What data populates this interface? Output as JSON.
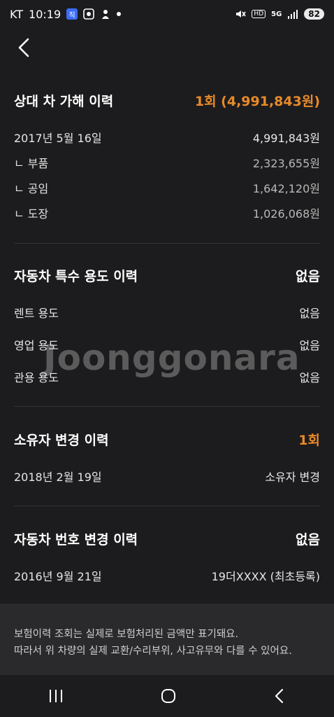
{
  "status_bar": {
    "carrier": "KT",
    "time": "10:19",
    "battery": "82",
    "network": "5G",
    "hd": "HD",
    "app_icon_text": "직"
  },
  "accident": {
    "title": "상대 차 가해 이력",
    "summary": "1회 (4,991,843원)",
    "date": "2017년 5월 16일",
    "total": "4,991,843원",
    "items": [
      {
        "label": "ㄴ 부품",
        "value": "2,323,655원"
      },
      {
        "label": "ㄴ 공임",
        "value": "1,642,120원"
      },
      {
        "label": "ㄴ 도장",
        "value": "1,026,068원"
      }
    ]
  },
  "special_use": {
    "title": "자동차 특수 용도 이력",
    "summary": "없음",
    "items": [
      {
        "label": "렌트 용도",
        "value": "없음"
      },
      {
        "label": "영업 용도",
        "value": "없음"
      },
      {
        "label": "관용 용도",
        "value": "없음"
      }
    ]
  },
  "owner_change": {
    "title": "소유자 변경 이력",
    "summary": "1회",
    "date": "2018년 2월 19일",
    "value": "소유자 변경"
  },
  "plate_change": {
    "title": "자동차 번호 변경 이력",
    "summary": "없음",
    "date": "2016년 9월 21일",
    "value": "19더XXXX (최초등록)"
  },
  "notice": {
    "line1": "보험이력 조회는 실제로 보험처리된 금액만 표기돼요.",
    "line2": "따라서 위 차량의 실제 교환/수리부위, 사고유무와 다를 수 있어요."
  },
  "watermark": "Joonggonara",
  "colors": {
    "background": "#1c1c1e",
    "accent": "#e88a2a",
    "divider": "#333336"
  }
}
